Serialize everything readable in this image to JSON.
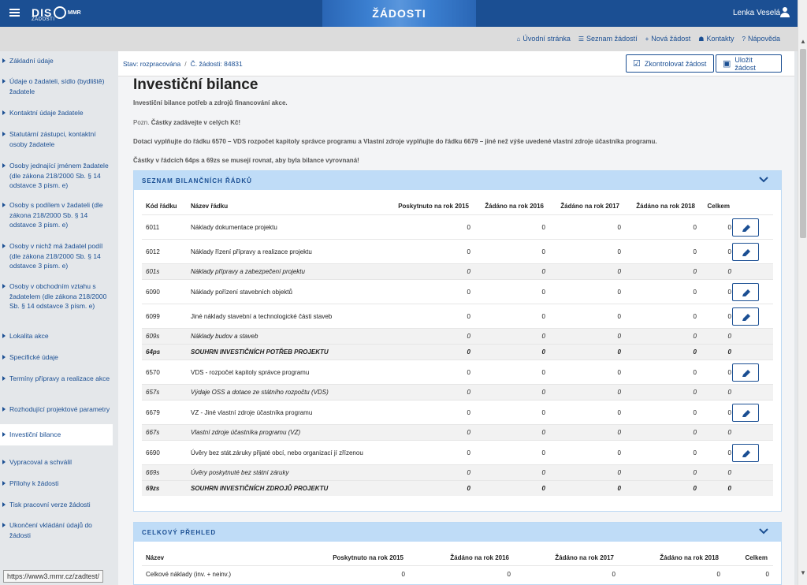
{
  "header": {
    "logo_text": "DIS",
    "logo_sub": "ŽÁDOSTI",
    "logo_mmr": "MMR",
    "banner_title": "ŽÁDOSTI",
    "user_name": "Lenka Veselá"
  },
  "nav": {
    "links": [
      {
        "icon": "home-icon",
        "glyph": "⌂",
        "label": "Úvodní stránka"
      },
      {
        "icon": "list-icon",
        "glyph": "☰",
        "label": "Seznam žádostí"
      },
      {
        "icon": "plus-icon",
        "glyph": "+",
        "label": "Nová žádost"
      },
      {
        "icon": "users-icon",
        "glyph": "☗",
        "label": "Kontakty"
      },
      {
        "icon": "help-icon",
        "glyph": "?",
        "label": "Nápověda"
      }
    ]
  },
  "sidebar": {
    "items": [
      "Základní údaje",
      "Údaje o žadateli, sídlo (bydliště) žadatele",
      "Kontaktní údaje žadatele",
      "Statutární zástupci, kontaktní osoby žadatele",
      "Osoby jednající jménem žadatele (dle zákona 218/2000 Sb. § 14 odstavce 3 písm. e)",
      "Osoby s podílem v žadateli (dle zákona 218/2000 Sb. § 14 odstavce 3 písm. e)",
      "Osoby v nichž má žadatel podíl (dle zákona 218/2000 Sb. § 14 odstavce 3 písm. e)",
      "Osoby v obchodním vztahu s žadatelem (dle zákona 218/2000 Sb. § 14 odstavce 3 písm. e)",
      "Lokalita akce",
      "Specifické údaje",
      "Termíny přípravy a realizace akce",
      "Rozhodující projektové parametry",
      "Investiční bilance",
      "Vypracoval a schválil",
      "Přílohy k žádosti",
      "Tisk pracovní verze žádosti",
      "Ukončení vkládání údajů do žádosti"
    ],
    "active_index": 12
  },
  "statusbar": {
    "state_label": "Stav: rozpracována",
    "separator": "/",
    "request_no": "Č. žádosti: 84831",
    "check_button": "Zkontrolovat žádost",
    "save_button": "Uložit žádost"
  },
  "page": {
    "title": "Investiční bilance",
    "subtitle": "Investiční bilance potřeb a zdrojů financování akce.",
    "note_prefix": "Pozn.",
    "note_text": "Částky zadávejte v celých Kč!",
    "instruction": "Dotaci vyplňujte do řádku 6570 – VDS rozpočet kapitoly správce programu a Vlastní zdroje vyplňujte do řádku 6679 – jiné než výše uvedené vlastní zdroje účastníka programu.",
    "balance_note": "Částky v řádcích 64ps a 69zs se musejí rovnat, aby byla bilance vyrovnaná!"
  },
  "balance_panel": {
    "title": "SEZNAM BILANČNÍCH ŘÁDKŮ",
    "columns": [
      "Kód řádku",
      "Název řádku",
      "Poskytnuto na rok 2015",
      "Žádáno na rok 2016",
      "Žádáno na rok 2017",
      "Žádáno na rok 2018",
      "Celkem"
    ],
    "rows": [
      {
        "code": "6011",
        "name": "Náklady dokumentace projektu",
        "v": [
          "0",
          "0",
          "0",
          "0",
          "0"
        ],
        "type": "edit"
      },
      {
        "code": "6012",
        "name": "Náklady řízení přípravy a realizace projektu",
        "v": [
          "0",
          "0",
          "0",
          "0",
          "0"
        ],
        "type": "edit"
      },
      {
        "code": "601s",
        "name": "Náklady přípravy a zabezpečení projektu",
        "v": [
          "0",
          "0",
          "0",
          "0",
          "0"
        ],
        "type": "sub"
      },
      {
        "code": "6090",
        "name": "Náklady pořízení stavebních objektů",
        "v": [
          "0",
          "0",
          "0",
          "0",
          "0"
        ],
        "type": "edit"
      },
      {
        "code": "6099",
        "name": "Jiné náklady stavební a technologické části staveb",
        "v": [
          "0",
          "0",
          "0",
          "0",
          "0"
        ],
        "type": "edit"
      },
      {
        "code": "609s",
        "name": "Náklady budov a staveb",
        "v": [
          "0",
          "0",
          "0",
          "0",
          "0"
        ],
        "type": "sub"
      },
      {
        "code": "64ps",
        "name": "SOUHRN INVESTIČNÍCH POTŘEB PROJEKTU",
        "v": [
          "0",
          "0",
          "0",
          "0",
          "0"
        ],
        "type": "sum"
      },
      {
        "code": "6570",
        "name": "VDS - rozpočet kapitoly správce programu",
        "v": [
          "0",
          "0",
          "0",
          "0",
          "0"
        ],
        "type": "edit"
      },
      {
        "code": "657s",
        "name": "Výdaje OSS a dotace ze státního rozpočtu (VDS)",
        "v": [
          "0",
          "0",
          "0",
          "0",
          "0"
        ],
        "type": "sub"
      },
      {
        "code": "6679",
        "name": "VZ - Jiné vlastní zdroje účastníka programu",
        "v": [
          "0",
          "0",
          "0",
          "0",
          "0"
        ],
        "type": "edit"
      },
      {
        "code": "667s",
        "name": "Vlastní zdroje účastníka programu (VZ)",
        "v": [
          "0",
          "0",
          "0",
          "0",
          "0"
        ],
        "type": "sub"
      },
      {
        "code": "6690",
        "name": "Úvěry bez stát.záruky přijaté obcí, nebo organizací jí zřízenou",
        "v": [
          "0",
          "0",
          "0",
          "0",
          "0"
        ],
        "type": "edit"
      },
      {
        "code": "669s",
        "name": "Úvěry poskytnuté bez státní záruky",
        "v": [
          "0",
          "0",
          "0",
          "0",
          "0"
        ],
        "type": "sub"
      },
      {
        "code": "69zs",
        "name": "SOUHRN INVESTIČNÍCH ZDROJŮ PROJEKTU",
        "v": [
          "0",
          "0",
          "0",
          "0",
          "0"
        ],
        "type": "sum"
      }
    ]
  },
  "overview_panel": {
    "title": "CELKOVÝ PŘEHLED",
    "columns": [
      "Název",
      "Poskytnuto na rok 2015",
      "Žádáno na rok 2016",
      "Žádáno na rok 2017",
      "Žádáno na rok 2018",
      "Celkem"
    ],
    "rows": [
      {
        "name": "Celkové náklady (inv. + neinv.)",
        "v": [
          "0",
          "0",
          "0",
          "0",
          "0"
        ]
      }
    ]
  },
  "status_url": "https://www3.mmr.cz/zadtest/"
}
